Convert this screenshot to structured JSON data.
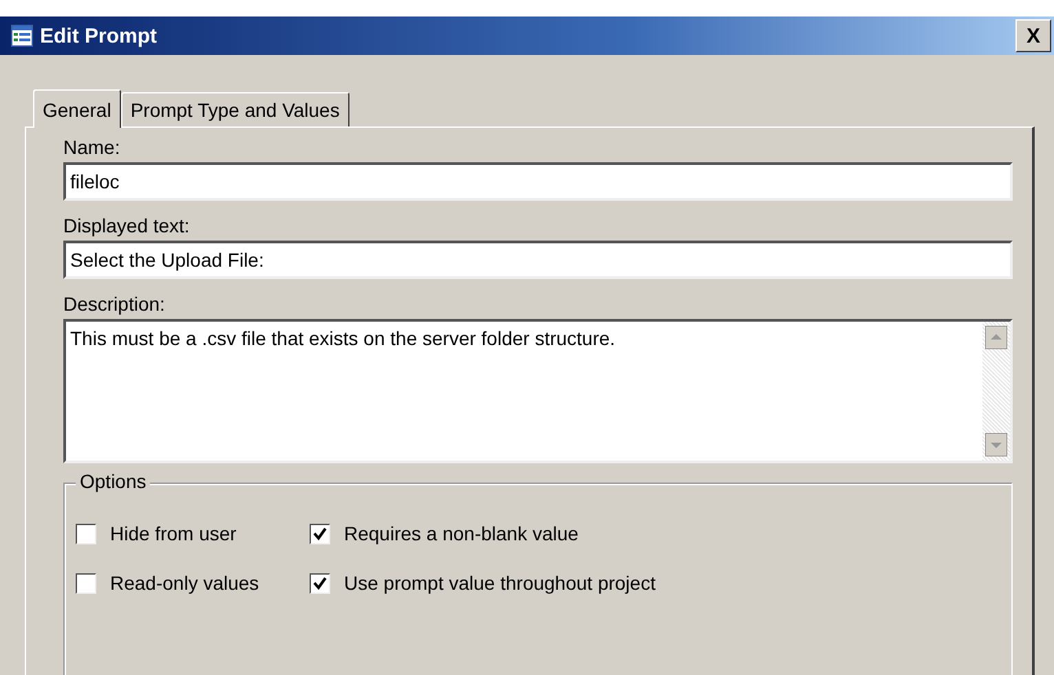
{
  "window": {
    "title": "Edit Prompt",
    "close": "X"
  },
  "tabs": [
    {
      "label": "General",
      "selected": true
    },
    {
      "label": "Prompt Type and Values",
      "selected": false
    }
  ],
  "fields": [
    {
      "label": "Name:",
      "value": "fileloc"
    },
    {
      "label": "Displayed text:",
      "value": "Select the Upload File:"
    }
  ],
  "description": {
    "label": "Description:",
    "value": "This must be a .csv file that exists on the server folder structure."
  },
  "options": {
    "title": "Options",
    "items": [
      {
        "label": "Hide from user",
        "checked": false
      },
      {
        "label": "Requires a non-blank value",
        "checked": true
      },
      {
        "label": "Read-only values",
        "checked": false
      },
      {
        "label": "Use prompt value throughout project",
        "checked": true
      }
    ]
  }
}
